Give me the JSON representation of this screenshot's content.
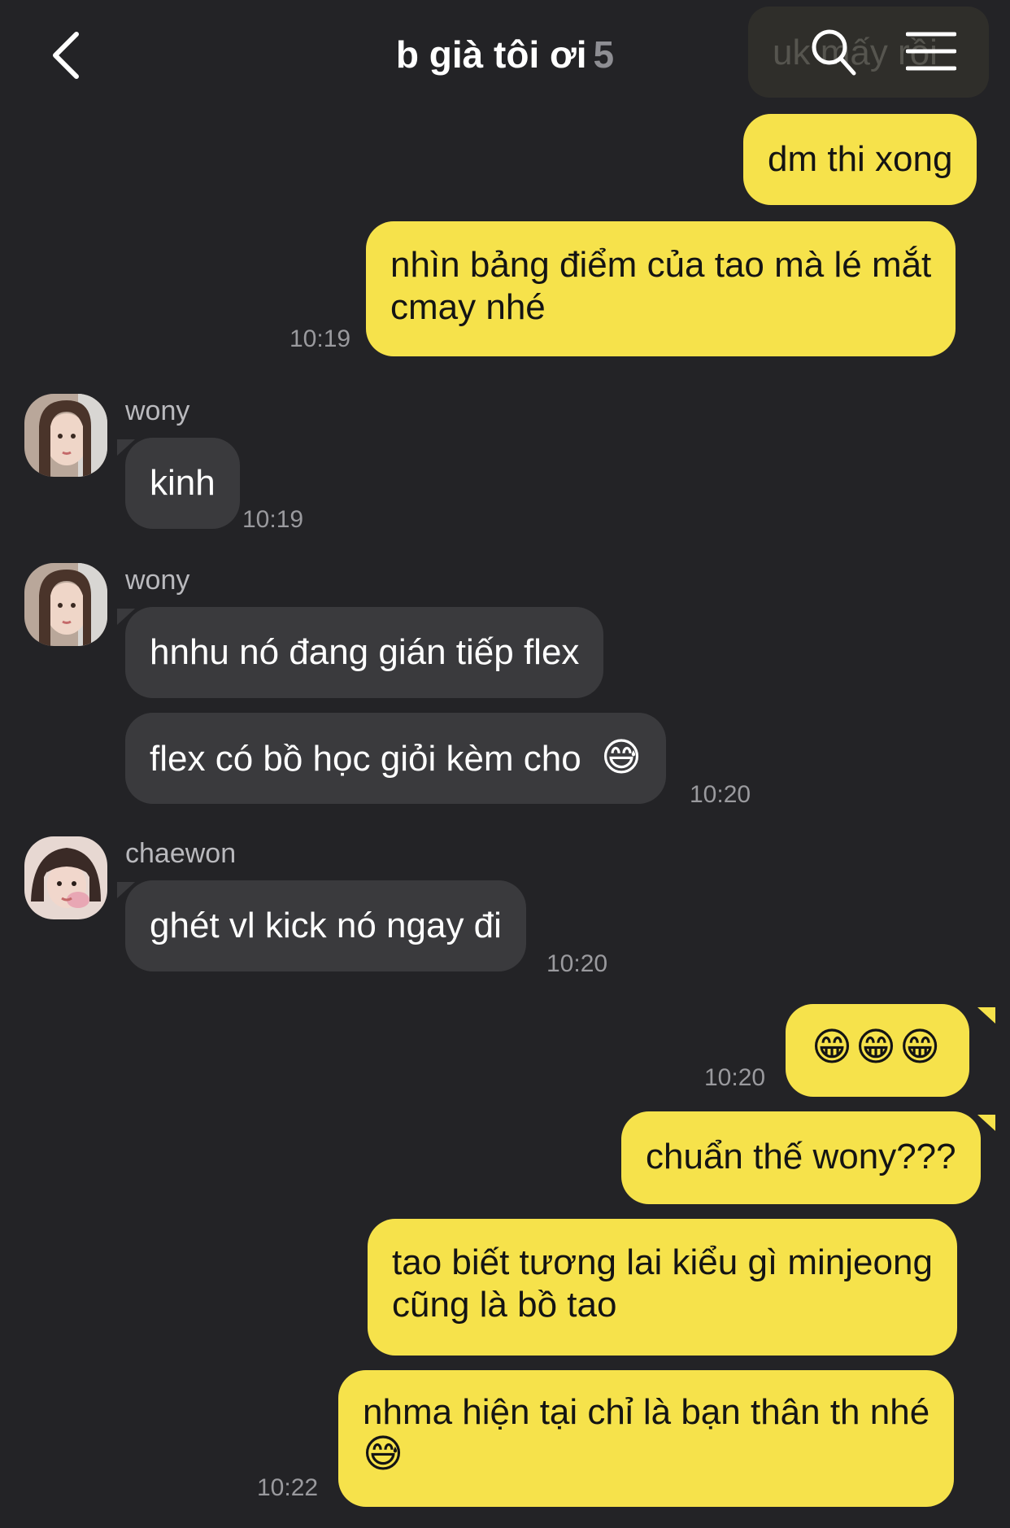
{
  "header": {
    "title": "b già tôi ơi",
    "member_count": "5",
    "peek_text": "uk mấy rồi"
  },
  "messages": [
    {
      "text": "dm thi xong"
    },
    {
      "line1": "nhìn bảng điểm của tao mà lé mắt",
      "line2": "cmay nhé",
      "time": "10:19"
    },
    {
      "sender": "wony",
      "text": "kinh",
      "time": "10:19"
    },
    {
      "sender": "wony",
      "text": "hnhu nó đang gián tiếp flex"
    },
    {
      "text": "flex có bồ học giỏi kèm cho",
      "emoji": "😅",
      "time": "10:20"
    },
    {
      "sender": "chaewon",
      "text": "ghét vl kick nó ngay đi",
      "time": "10:20"
    },
    {
      "emoji": "😁😁😁",
      "time": "10:20"
    },
    {
      "text": "chuẩn thế wony???"
    },
    {
      "line1": "tao biết tương lai kiểu gì minjeong",
      "line2": "cũng là bồ tao"
    },
    {
      "line1": "nhma hiện tại chỉ là bạn thân th nhé",
      "emoji": "😅",
      "time": "10:22"
    }
  ],
  "icons": [
    "back-arrow-icon",
    "search-icon",
    "menu-icon"
  ],
  "colors": {
    "background": "#232326",
    "my_bubble": "#f6e24b",
    "their_bubble": "#3a3a3d"
  }
}
